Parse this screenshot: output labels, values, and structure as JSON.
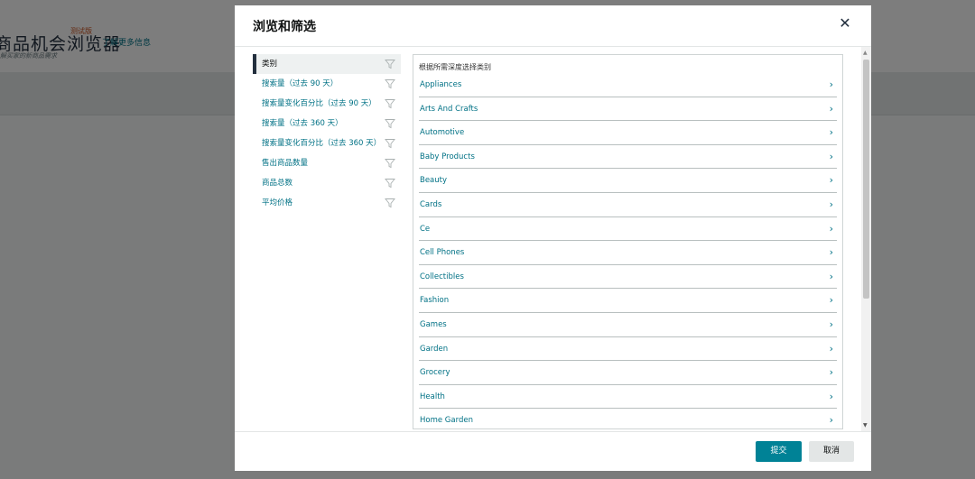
{
  "background": {
    "title": "商品机会浏览器",
    "badge": "测试版",
    "learn_more": "了解更多信息",
    "subtitle": "解买家的新商品需求"
  },
  "modal": {
    "title": "浏览和筛选",
    "close_icon": "close-icon",
    "filters": [
      {
        "label": "类别",
        "active": true
      },
      {
        "label": "搜索量（过去 90 天）",
        "active": false
      },
      {
        "label": "搜索量变化百分比（过去 90 天）",
        "active": false
      },
      {
        "label": "搜索量（过去 360 天）",
        "active": false
      },
      {
        "label": "搜索量变化百分比（过去 360 天）",
        "active": false
      },
      {
        "label": "售出商品数量",
        "active": false
      },
      {
        "label": "商品总数",
        "active": false
      },
      {
        "label": "平均价格",
        "active": false
      }
    ],
    "category_hint": "根据所需深度选择类别",
    "categories": [
      "Appliances",
      "Arts And Crafts",
      "Automotive",
      "Baby Products",
      "Beauty",
      "Cards",
      "Ce",
      "Cell Phones",
      "Collectibles",
      "Fashion",
      "Games",
      "Garden",
      "Grocery",
      "Health",
      "Home Garden"
    ],
    "submit_label": "提交",
    "cancel_label": "取消",
    "colors": {
      "accent": "#008296",
      "link": "#007185",
      "dark": "#232f3e"
    }
  }
}
